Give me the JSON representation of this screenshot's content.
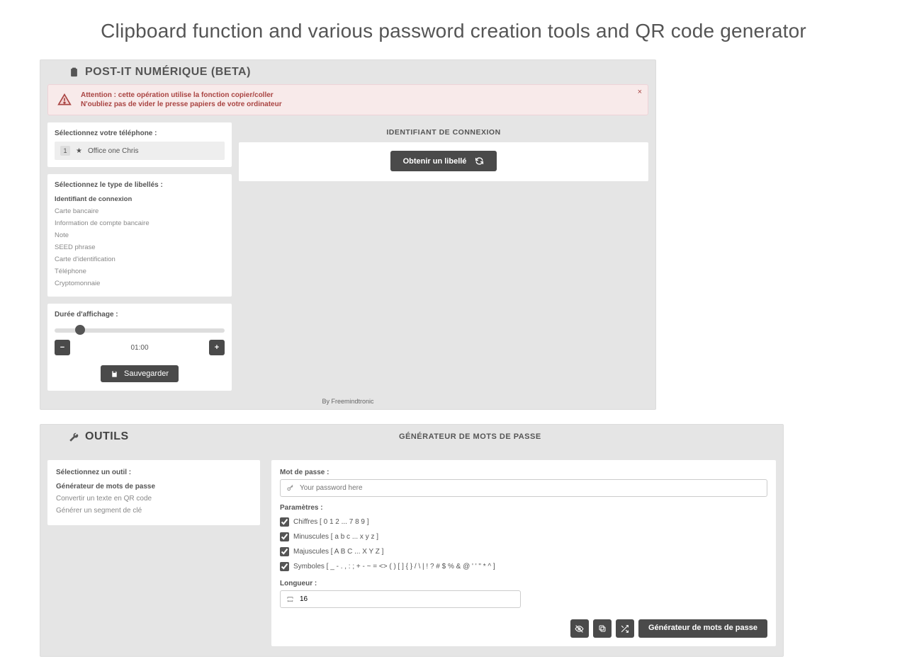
{
  "page_title": "Clipboard function and various password creation tools and QR code generator",
  "postit": {
    "header": "POST-IT NUMÉRIQUE (BETA)",
    "alert": {
      "line1": "Attention : cette opération utilise la fonction copier/coller",
      "line2": "N'oubliez pas de vider le presse papiers de votre ordinateur"
    },
    "phone": {
      "label": "Sélectionnez votre téléphone :",
      "index": "1",
      "name": "Office one Chris"
    },
    "types": {
      "label": "Sélectionnez le type de libellés :",
      "items": [
        "Identifiant de connexion",
        "Carte bancaire",
        "Information de compte bancaire",
        "Note",
        "SEED phrase",
        "Carte d'identification",
        "Téléphone",
        "Cryptomonnaie"
      ],
      "activeIndex": 0
    },
    "duration": {
      "label": "Durée d'affichage :",
      "value": "01:00",
      "save_label": "Sauvegarder"
    },
    "right": {
      "title": "IDENTIFIANT DE CONNEXION",
      "button_label": "Obtenir un libellé"
    },
    "footer": "By Freemindtronic"
  },
  "tools": {
    "header": "OUTILS",
    "right_title": "GÉNÉRATEUR DE MOTS DE PASSE",
    "select": {
      "label": "Sélectionnez un outil :",
      "items": [
        "Générateur de mots de passe",
        "Convertir un texte en QR code",
        "Générer un segment de clé"
      ],
      "activeIndex": 0
    },
    "gen": {
      "password_label": "Mot de passe :",
      "password_placeholder": "Your password here",
      "params_label": "Paramètres :",
      "p_digits": "Chiffres [ 0 1 2 ... 7 8 9 ]",
      "p_lower": "Minuscules [ a b c ... x y z ]",
      "p_upper": "Majuscules [ A B C ... X Y Z ]",
      "p_symbols": "Symboles [ _ - . , : ; + - ~ = <> ( ) [ ] { } / \\ | ! ? # $ % & @ ' ' \" * ^ ]",
      "length_label": "Longueur :",
      "length_value": "16",
      "generate_label": "Générateur de mots de passe"
    }
  }
}
